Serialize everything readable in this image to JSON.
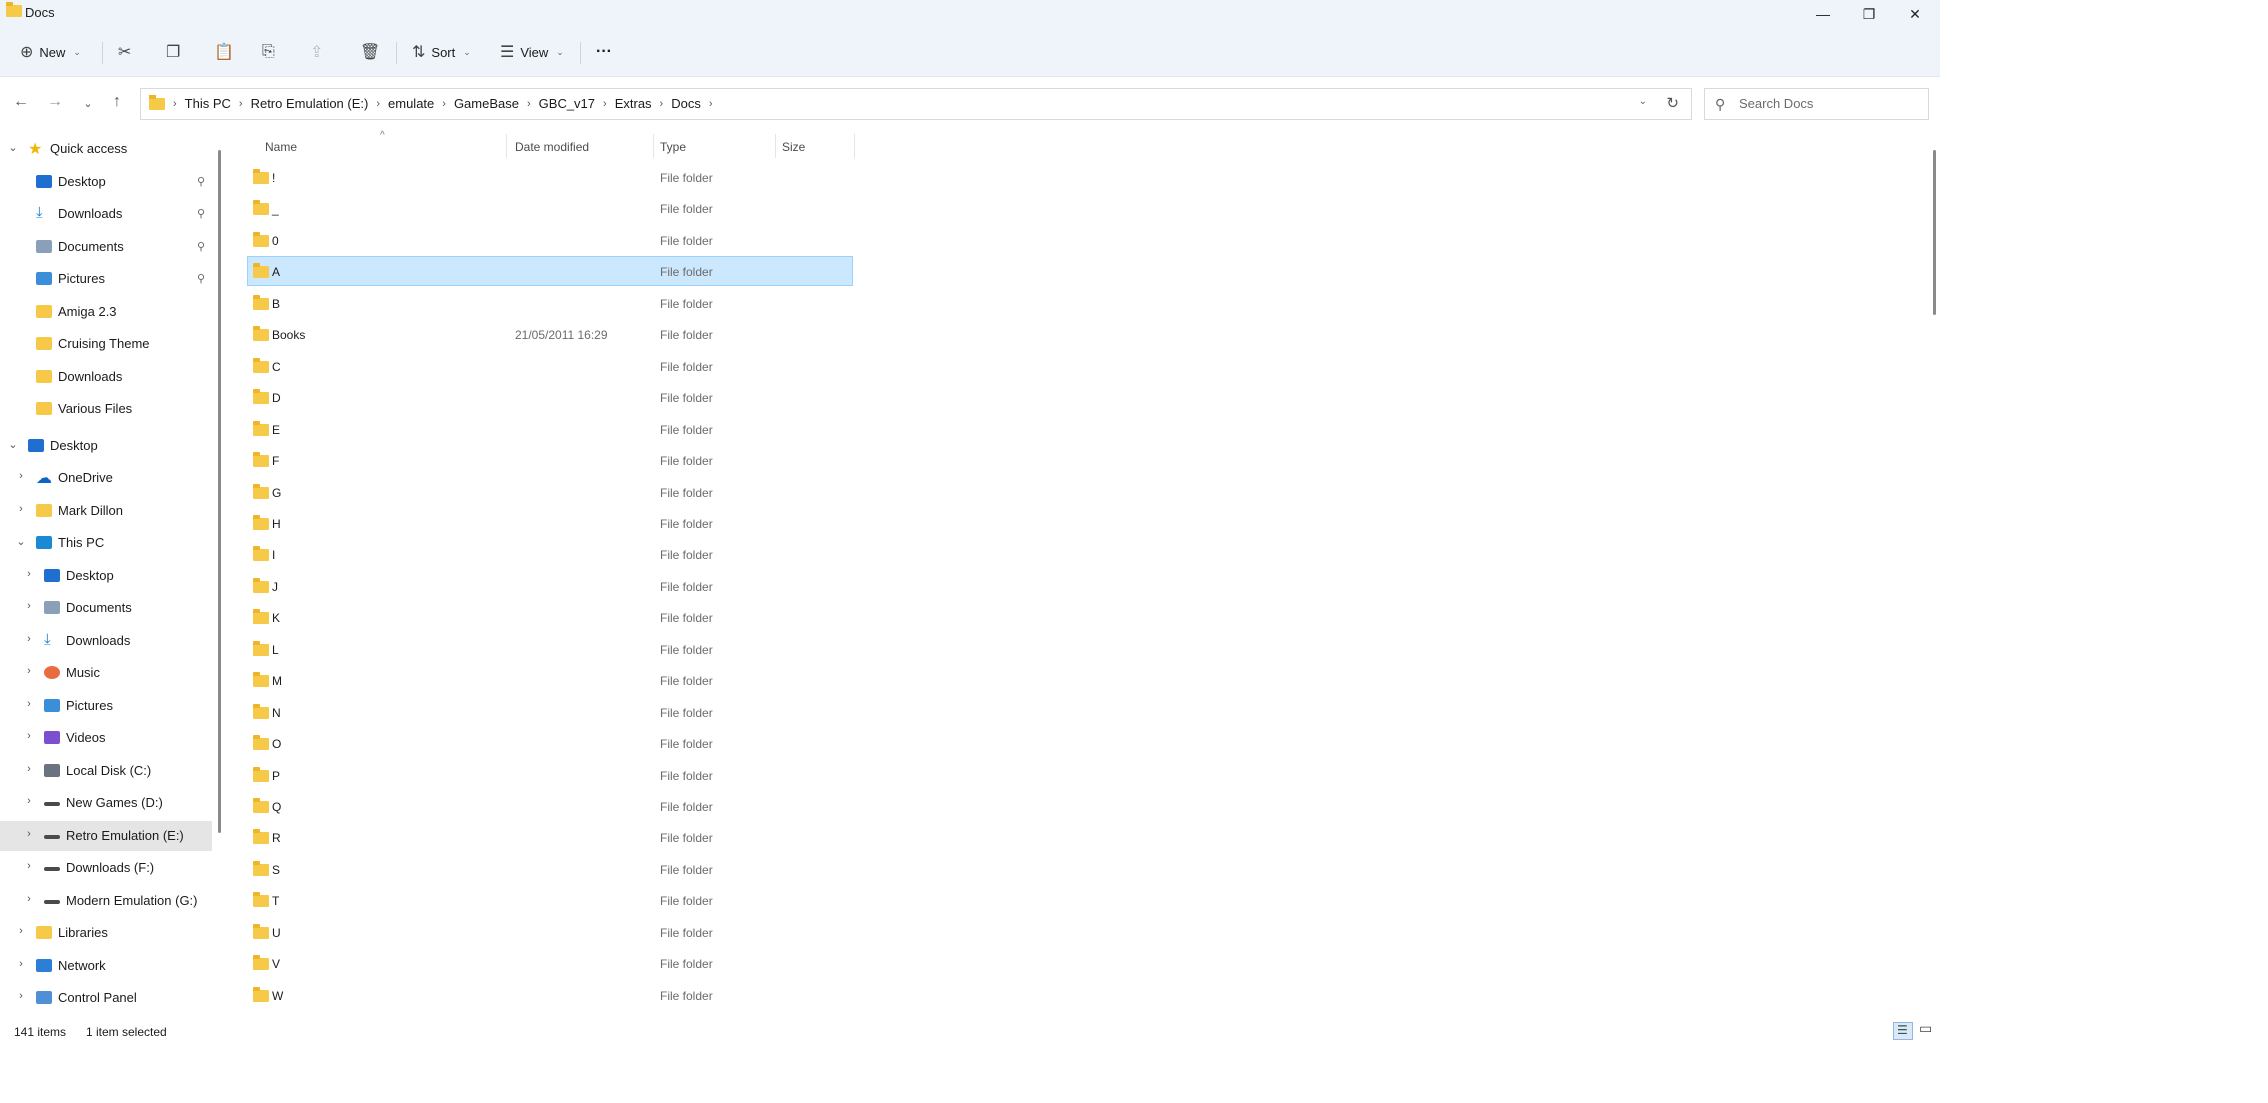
{
  "window": {
    "title": "Docs",
    "controls": {
      "minimize": "—",
      "maximize": "❐",
      "close": "✕"
    }
  },
  "toolbar": {
    "new_label": "New",
    "sort_label": "Sort",
    "view_label": "View",
    "more_label": "···"
  },
  "address": {
    "breadcrumbs": [
      "This PC",
      "Retro Emulation (E:)",
      "emulate",
      "GameBase",
      "GBC_v17",
      "Extras",
      "Docs"
    ],
    "separator": "›"
  },
  "search": {
    "placeholder": "Search Docs"
  },
  "nav_pane": {
    "quick_access": {
      "label": "Quick access",
      "items": [
        {
          "label": "Desktop",
          "pinned": true,
          "icon": "desktop-icon"
        },
        {
          "label": "Downloads",
          "pinned": true,
          "icon": "download-icon"
        },
        {
          "label": "Documents",
          "pinned": true,
          "icon": "documents-icon"
        },
        {
          "label": "Pictures",
          "pinned": true,
          "icon": "pictures-icon"
        },
        {
          "label": "Amiga 2.3",
          "pinned": false,
          "icon": "folder-icon"
        },
        {
          "label": "Cruising Theme",
          "pinned": false,
          "icon": "folder-icon"
        },
        {
          "label": "Downloads",
          "pinned": false,
          "icon": "folder-icon"
        },
        {
          "label": "Various Files",
          "pinned": false,
          "icon": "folder-icon"
        }
      ]
    },
    "desktop": {
      "label": "Desktop",
      "children": [
        {
          "label": "OneDrive",
          "icon": "cloud-icon"
        },
        {
          "label": "Mark Dillon",
          "icon": "folder-icon"
        }
      ]
    },
    "this_pc": {
      "label": "This PC",
      "children": [
        {
          "label": "Desktop",
          "icon": "desktop-icon"
        },
        {
          "label": "Documents",
          "icon": "documents-icon"
        },
        {
          "label": "Downloads",
          "icon": "download-icon"
        },
        {
          "label": "Music",
          "icon": "music-icon"
        },
        {
          "label": "Pictures",
          "icon": "pictures-icon"
        },
        {
          "label": "Videos",
          "icon": "videos-icon"
        },
        {
          "label": "Local Disk (C:)",
          "icon": "system-drive-icon"
        },
        {
          "label": "New Games (D:)",
          "icon": "drive-icon"
        },
        {
          "label": "Retro Emulation (E:)",
          "icon": "drive-icon",
          "selected": true
        },
        {
          "label": "Downloads (F:)",
          "icon": "drive-icon"
        },
        {
          "label": "Modern Emulation (G:)",
          "icon": "drive-icon"
        }
      ]
    },
    "bottom": [
      {
        "label": "Libraries",
        "icon": "libraries-icon"
      },
      {
        "label": "Network",
        "icon": "network-icon"
      },
      {
        "label": "Control Panel",
        "icon": "control-panel-icon"
      }
    ],
    "pin_glyph": "📌"
  },
  "columns": {
    "name": "Name",
    "date": "Date modified",
    "type": "Type",
    "size": "Size"
  },
  "files": [
    {
      "name": "!",
      "date": "",
      "type": "File folder"
    },
    {
      "name": "_",
      "date": "",
      "type": "File folder"
    },
    {
      "name": "0",
      "date": "",
      "type": "File folder"
    },
    {
      "name": "A",
      "date": "",
      "type": "File folder",
      "selected": true
    },
    {
      "name": "B",
      "date": "",
      "type": "File folder"
    },
    {
      "name": "Books",
      "date": "21/05/2011 16:29",
      "type": "File folder"
    },
    {
      "name": "C",
      "date": "",
      "type": "File folder"
    },
    {
      "name": "D",
      "date": "",
      "type": "File folder"
    },
    {
      "name": "E",
      "date": "",
      "type": "File folder"
    },
    {
      "name": "F",
      "date": "",
      "type": "File folder"
    },
    {
      "name": "G",
      "date": "",
      "type": "File folder"
    },
    {
      "name": "H",
      "date": "",
      "type": "File folder"
    },
    {
      "name": "I",
      "date": "",
      "type": "File folder"
    },
    {
      "name": "J",
      "date": "",
      "type": "File folder"
    },
    {
      "name": "K",
      "date": "",
      "type": "File folder"
    },
    {
      "name": "L",
      "date": "",
      "type": "File folder"
    },
    {
      "name": "M",
      "date": "",
      "type": "File folder"
    },
    {
      "name": "N",
      "date": "",
      "type": "File folder"
    },
    {
      "name": "O",
      "date": "",
      "type": "File folder"
    },
    {
      "name": "P",
      "date": "",
      "type": "File folder"
    },
    {
      "name": "Q",
      "date": "",
      "type": "File folder"
    },
    {
      "name": "R",
      "date": "",
      "type": "File folder"
    },
    {
      "name": "S",
      "date": "",
      "type": "File folder"
    },
    {
      "name": "T",
      "date": "",
      "type": "File folder"
    },
    {
      "name": "U",
      "date": "",
      "type": "File folder"
    },
    {
      "name": "V",
      "date": "",
      "type": "File folder"
    },
    {
      "name": "W",
      "date": "",
      "type": "File folder"
    }
  ],
  "status": {
    "item_count": "141 items",
    "selection": "1 item selected"
  },
  "colors": {
    "selection": "#cce8ff",
    "chrome": "#eef4f9",
    "folder": "#f7c948"
  }
}
